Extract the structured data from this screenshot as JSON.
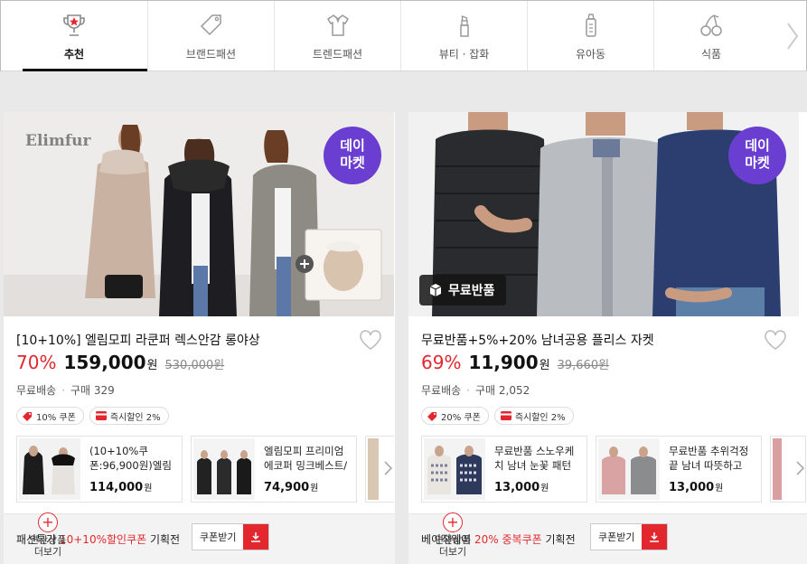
{
  "nav": {
    "categories": [
      {
        "label": "추천",
        "icon": "trophy-icon",
        "active": true
      },
      {
        "label": "브랜드패션",
        "icon": "price-tag-icon"
      },
      {
        "label": "트렌드패션",
        "icon": "shirt-icon"
      },
      {
        "label": "뷰티 · 잡화",
        "icon": "lipstick-icon"
      },
      {
        "label": "유아동",
        "icon": "baby-bottle-icon"
      },
      {
        "label": "식품",
        "icon": "cherry-icon"
      }
    ]
  },
  "colors": {
    "accent": "#e2282e",
    "badge": "#6b3ed2",
    "active_underline": "#111111"
  },
  "cards": [
    {
      "badge": "데이\n마켓",
      "brand_watermark": "Elimfur",
      "title": "[10+10%] 엘림모피 라쿤퍼 렉스안감 롱야상",
      "discount": "70%",
      "price": "159,000",
      "won": "원",
      "original_price": "530,000원",
      "shipping": "무료배송",
      "purchases": "구매 329",
      "tag_coupon": "10% 쿠폰",
      "tag_instant": "즉시할인 2%",
      "related": [
        {
          "title": "(10+10%쿠폰:96,900원)엘림",
          "price": "114,000"
        },
        {
          "title": "엘림모피 프리미엄 에코퍼 밍크베스트/",
          "price": "74,900"
        }
      ],
      "footer_prefix": "패션특가 ",
      "footer_highlight": "10+10%할인쿠폰",
      "footer_suffix": " 기획전",
      "coupon_button": "쿠폰받기",
      "add_more_label": "연관상품\n더보기"
    },
    {
      "badge": "데이\n마켓",
      "free_return": "무료반품",
      "title": "무료반품+5%+20% 남녀공용 플리스 자켓",
      "discount": "69%",
      "price": "11,900",
      "won": "원",
      "original_price": "39,660원",
      "shipping": "무료배송",
      "purchases": "구매 2,052",
      "tag_coupon": "20% 쿠폰",
      "tag_instant": "즉시할인 2%",
      "related": [
        {
          "title": "무료반품 스노우케치 남녀 눈꽃 패턴",
          "price": "13,000"
        },
        {
          "title": "무료반품 추위걱정 끝 남녀 따뜻하고",
          "price": "13,000"
        }
      ],
      "footer_prefix": "베이직웨어 ",
      "footer_highlight": "20% 중복쿠폰",
      "footer_suffix": " 기획전",
      "coupon_button": "쿠폰받기",
      "add_more_label": "연관상품\n더보기"
    }
  ]
}
